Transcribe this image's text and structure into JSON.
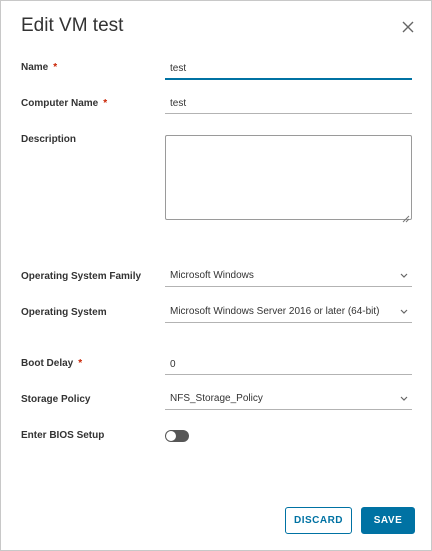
{
  "dialog": {
    "title": "Edit VM test"
  },
  "form": {
    "name": {
      "label": "Name",
      "required_mark": "*",
      "value": "test"
    },
    "computer_name": {
      "label": "Computer Name",
      "required_mark": "*",
      "value": "test"
    },
    "description": {
      "label": "Description",
      "value": ""
    },
    "os_family": {
      "label": "Operating System Family",
      "value": "Microsoft Windows"
    },
    "os": {
      "label": "Operating System",
      "value": "Microsoft Windows Server 2016 or later (64-bit)"
    },
    "boot_delay": {
      "label": "Boot Delay",
      "required_mark": "*",
      "value": "0"
    },
    "storage_policy": {
      "label": "Storage Policy",
      "value": "NFS_Storage_Policy"
    },
    "bios_setup": {
      "label": "Enter BIOS Setup",
      "enabled": false
    }
  },
  "buttons": {
    "discard": "DISCARD",
    "save": "SAVE"
  },
  "icons": {
    "close": "close-icon",
    "chevron": "chevron-down-icon"
  },
  "colors": {
    "accent": "#0072a3",
    "required": "#c92100",
    "toggle_off": "#565656"
  }
}
